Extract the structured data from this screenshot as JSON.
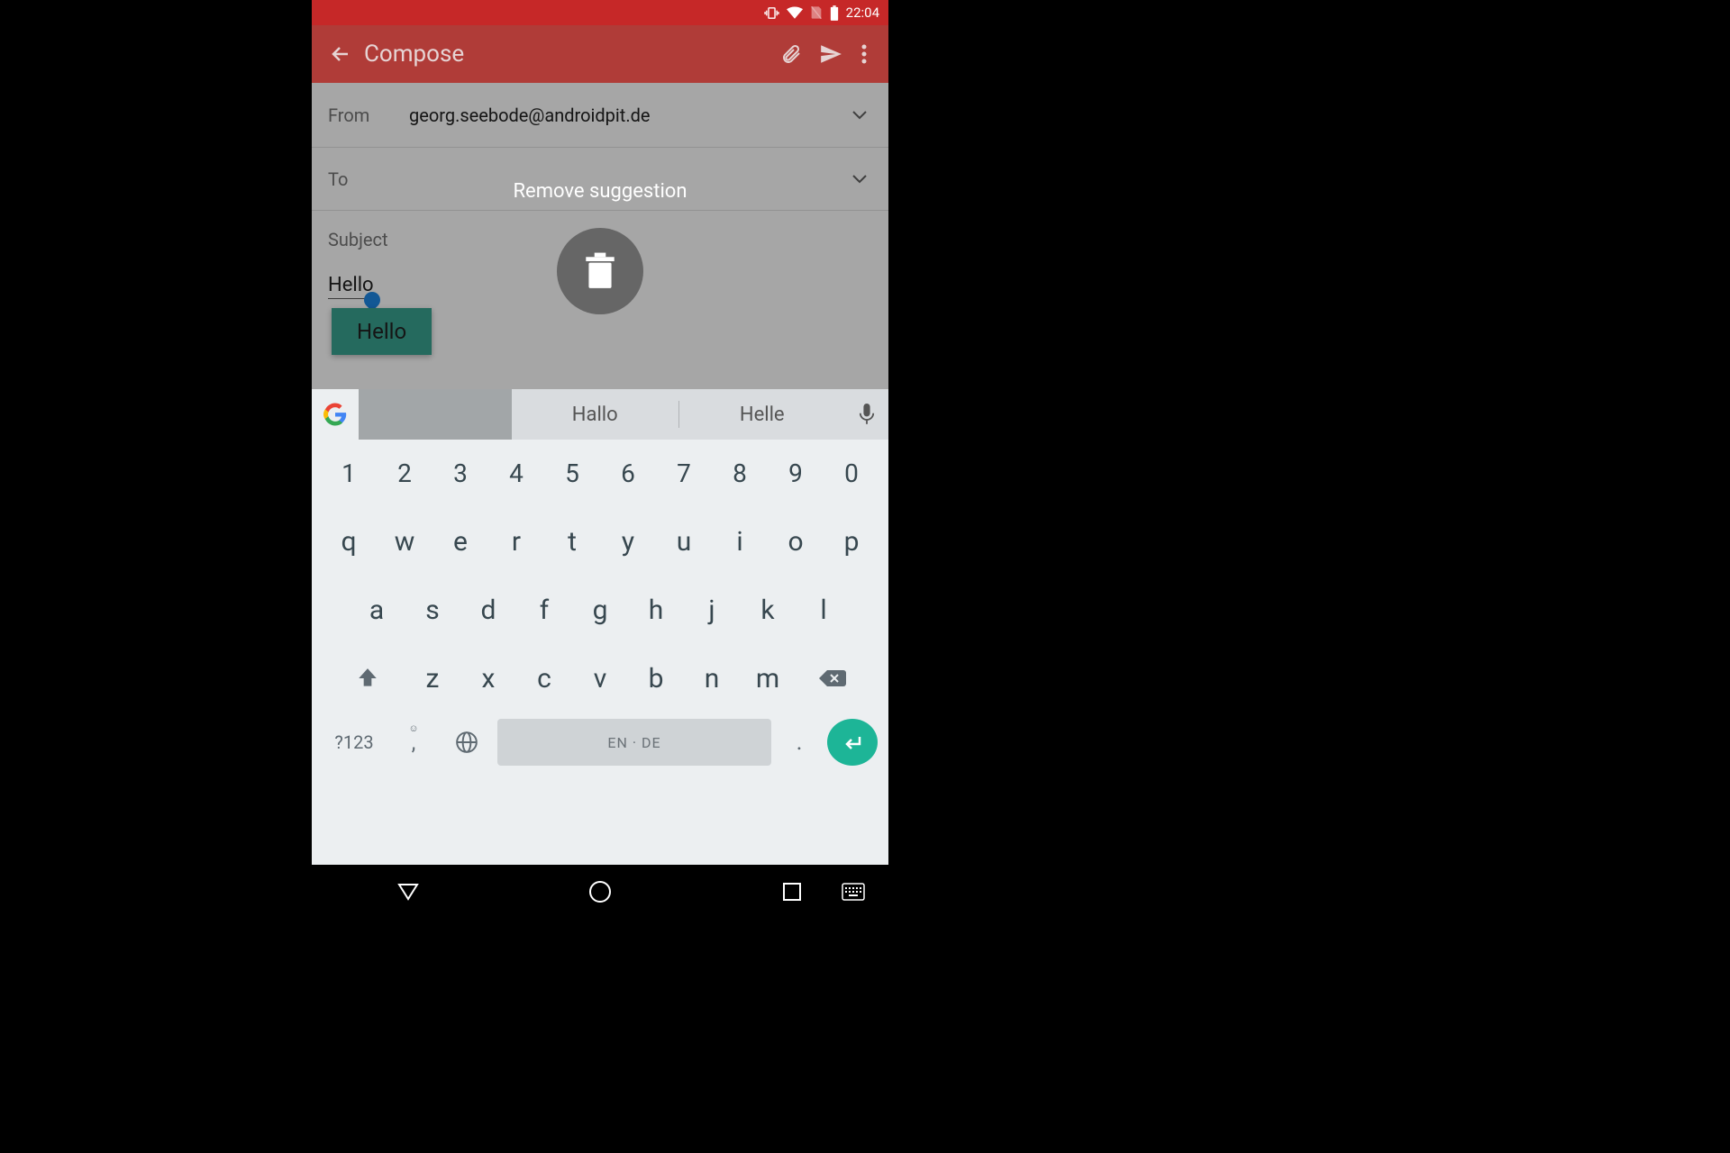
{
  "statusbar": {
    "time": "22:04"
  },
  "appbar": {
    "title": "Compose"
  },
  "compose": {
    "from_label": "From",
    "from_value": "georg.seebode@androidpit.de",
    "to_label": "To",
    "subject_label": "Subject",
    "body_text": "Hello",
    "tooltip_text": "Hello"
  },
  "popup": {
    "title": "Remove suggestion"
  },
  "suggestions": {
    "s1": "Hallo",
    "s2": "Helle"
  },
  "keyboard": {
    "nums": [
      "1",
      "2",
      "3",
      "4",
      "5",
      "6",
      "7",
      "8",
      "9",
      "0"
    ],
    "r1": [
      "q",
      "w",
      "e",
      "r",
      "t",
      "y",
      "u",
      "i",
      "o",
      "p"
    ],
    "r2": [
      "a",
      "s",
      "d",
      "f",
      "g",
      "h",
      "j",
      "k",
      "l"
    ],
    "r3": [
      "z",
      "x",
      "c",
      "v",
      "b",
      "n",
      "m"
    ],
    "sym": "?123",
    "space": "EN · DE",
    "comma": ",",
    "dot": "."
  }
}
